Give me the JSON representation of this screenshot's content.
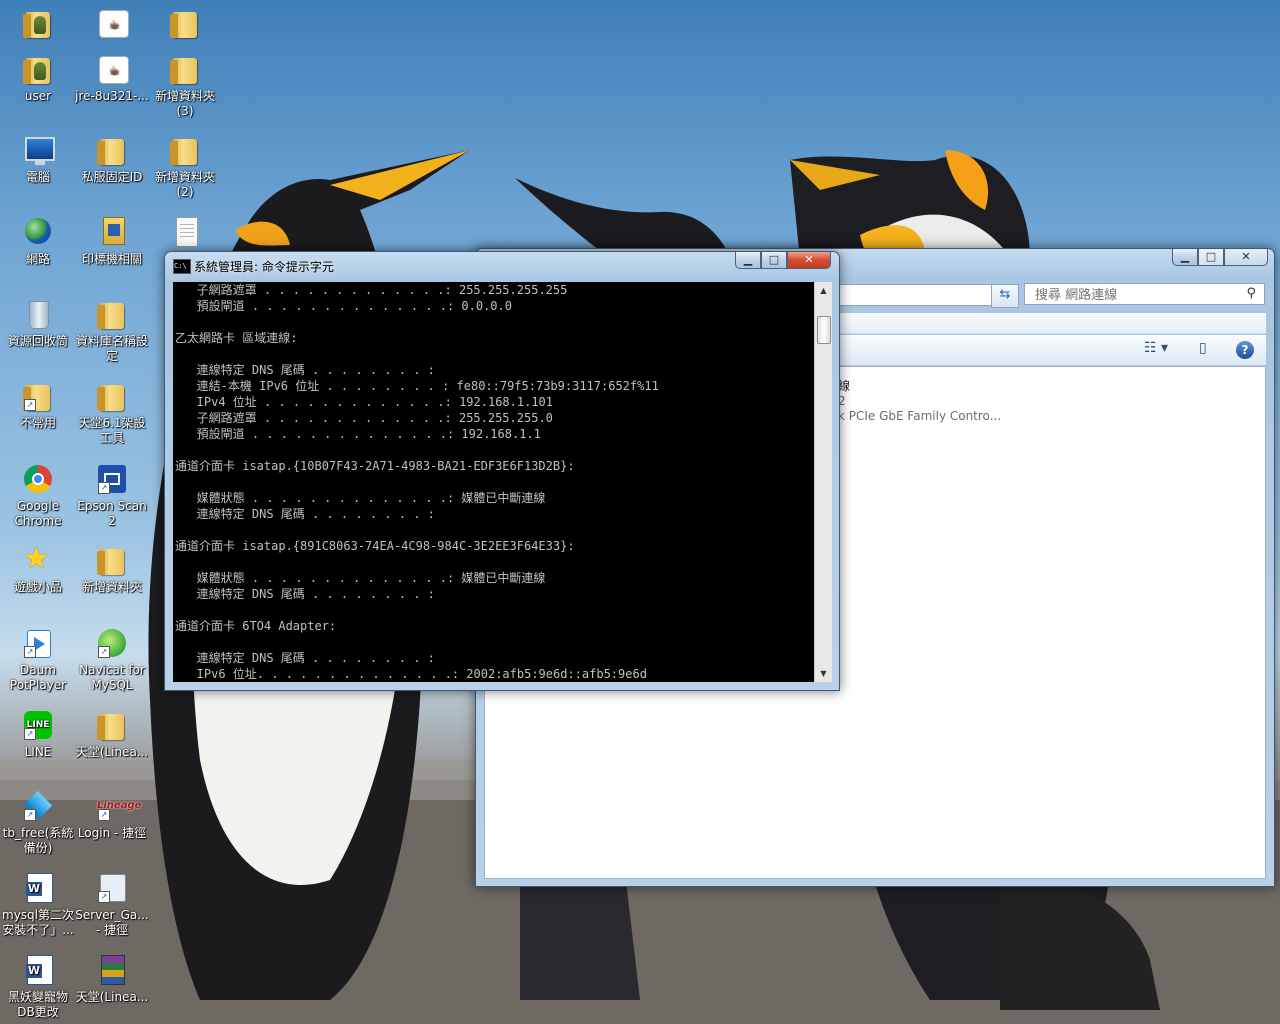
{
  "desktop": {
    "icons": [
      {
        "label": "",
        "icon": "user-folder-icon"
      },
      {
        "label": "",
        "icon": "java-installer-icon"
      },
      {
        "label": "",
        "icon": "folder-icon"
      },
      {
        "label": "user",
        "icon": "user-folder-icon"
      },
      {
        "label": "jre-8u321-...",
        "icon": "java-installer-icon"
      },
      {
        "label": "新增資料夾 (3)",
        "icon": "folder-icon"
      },
      {
        "label": "電腦",
        "icon": "computer-icon"
      },
      {
        "label": "私服固定ID",
        "icon": "folder-icon"
      },
      {
        "label": "新增資料夾 (2)",
        "icon": "folder-icon"
      },
      {
        "label": "網路",
        "icon": "network-icon"
      },
      {
        "label": "印標機相關",
        "icon": "folder-icon"
      },
      {
        "label": "",
        "icon": "text-document-icon"
      },
      {
        "label": "資源回收筒",
        "icon": "recycle-bin-icon"
      },
      {
        "label": "資料庫名稱設定",
        "icon": "folder-icon"
      },
      {
        "label": "不常用",
        "icon": "folder-icon"
      },
      {
        "label": "天堂6.1架設工具",
        "icon": "folder-icon"
      },
      {
        "label": "Google Chrome",
        "icon": "chrome-icon"
      },
      {
        "label": "Epson Scan 2",
        "icon": "epson-scan-icon"
      },
      {
        "label": "遊戲小品",
        "icon": "star-icon"
      },
      {
        "label": "新增資料夾",
        "icon": "folder-icon"
      },
      {
        "label": "Daum PotPlayer",
        "icon": "potplayer-icon"
      },
      {
        "label": "Navicat for MySQL",
        "icon": "navicat-icon"
      },
      {
        "label": "LINE",
        "icon": "line-icon"
      },
      {
        "label": "天堂(Linea...",
        "icon": "folder-icon"
      },
      {
        "label": "tb_free(系統備份)",
        "icon": "backup-tool-icon"
      },
      {
        "label": "Login - 捷徑",
        "icon": "lineage-login-icon"
      },
      {
        "label": "mysql第二次安裝不了」...",
        "icon": "word-document-icon"
      },
      {
        "label": "Server_Ga... - 捷徑",
        "icon": "server-shortcut-icon"
      },
      {
        "label": "黑妖變寵物DB更改",
        "icon": "word-document-icon"
      },
      {
        "label": "天堂(Linea...",
        "icon": "winrar-archive-icon"
      }
    ]
  },
  "cmd_window": {
    "title": "系統管理員: 命令提示字元",
    "icon_text": "C:\\",
    "lines": [
      "   子網路遮罩 . . . . . . . . . . . . .: 255.255.255.255",
      "   預設閘道 . . . . . . . . . . . . . .: 0.0.0.0",
      "",
      "乙太網路卡 區域連線:",
      "",
      "   連線特定 DNS 尾碼 . . . . . . . . :",
      "   連結-本機 IPv6 位址 . . . . . . . . : fe80::79f5:73b9:3117:652f%11",
      "   IPv4 位址 . . . . . . . . . . . . .: 192.168.1.101",
      "   子網路遮罩 . . . . . . . . . . . . .: 255.255.255.0",
      "   預設閘道 . . . . . . . . . . . . . .: 192.168.1.1",
      "",
      "通道介面卡 isatap.{10B07F43-2A71-4983-BA21-EDF3E6F13D2B}:",
      "",
      "   媒體狀態 . . . . . . . . . . . . . .: 媒體已中斷連線",
      "   連線特定 DNS 尾碼 . . . . . . . . :",
      "",
      "通道介面卡 isatap.{891C8063-74EA-4C98-984C-3E2EE3F64E33}:",
      "",
      "   媒體狀態 . . . . . . . . . . . . . .: 媒體已中斷連線",
      "   連線特定 DNS 尾碼 . . . . . . . . :",
      "",
      "通道介面卡 6TO4 Adapter:",
      "",
      "   連線特定 DNS 尾碼 . . . . . . . . :",
      "   IPv6 位址. . . . . . . . . . . . . .: 2002:afb5:9e6d::afb5:9e6d"
    ],
    "buttons": {
      "minimize": "▁",
      "maximize": "□",
      "close": "✕"
    }
  },
  "explorer_window": {
    "search_placeholder": "搜尋 網路連線",
    "connection": {
      "name": "線",
      "status": "2",
      "device": "k PCIe GbE Family Contro..."
    },
    "buttons": {
      "minimize": "▁",
      "maximize": "□",
      "close": "✕"
    }
  }
}
